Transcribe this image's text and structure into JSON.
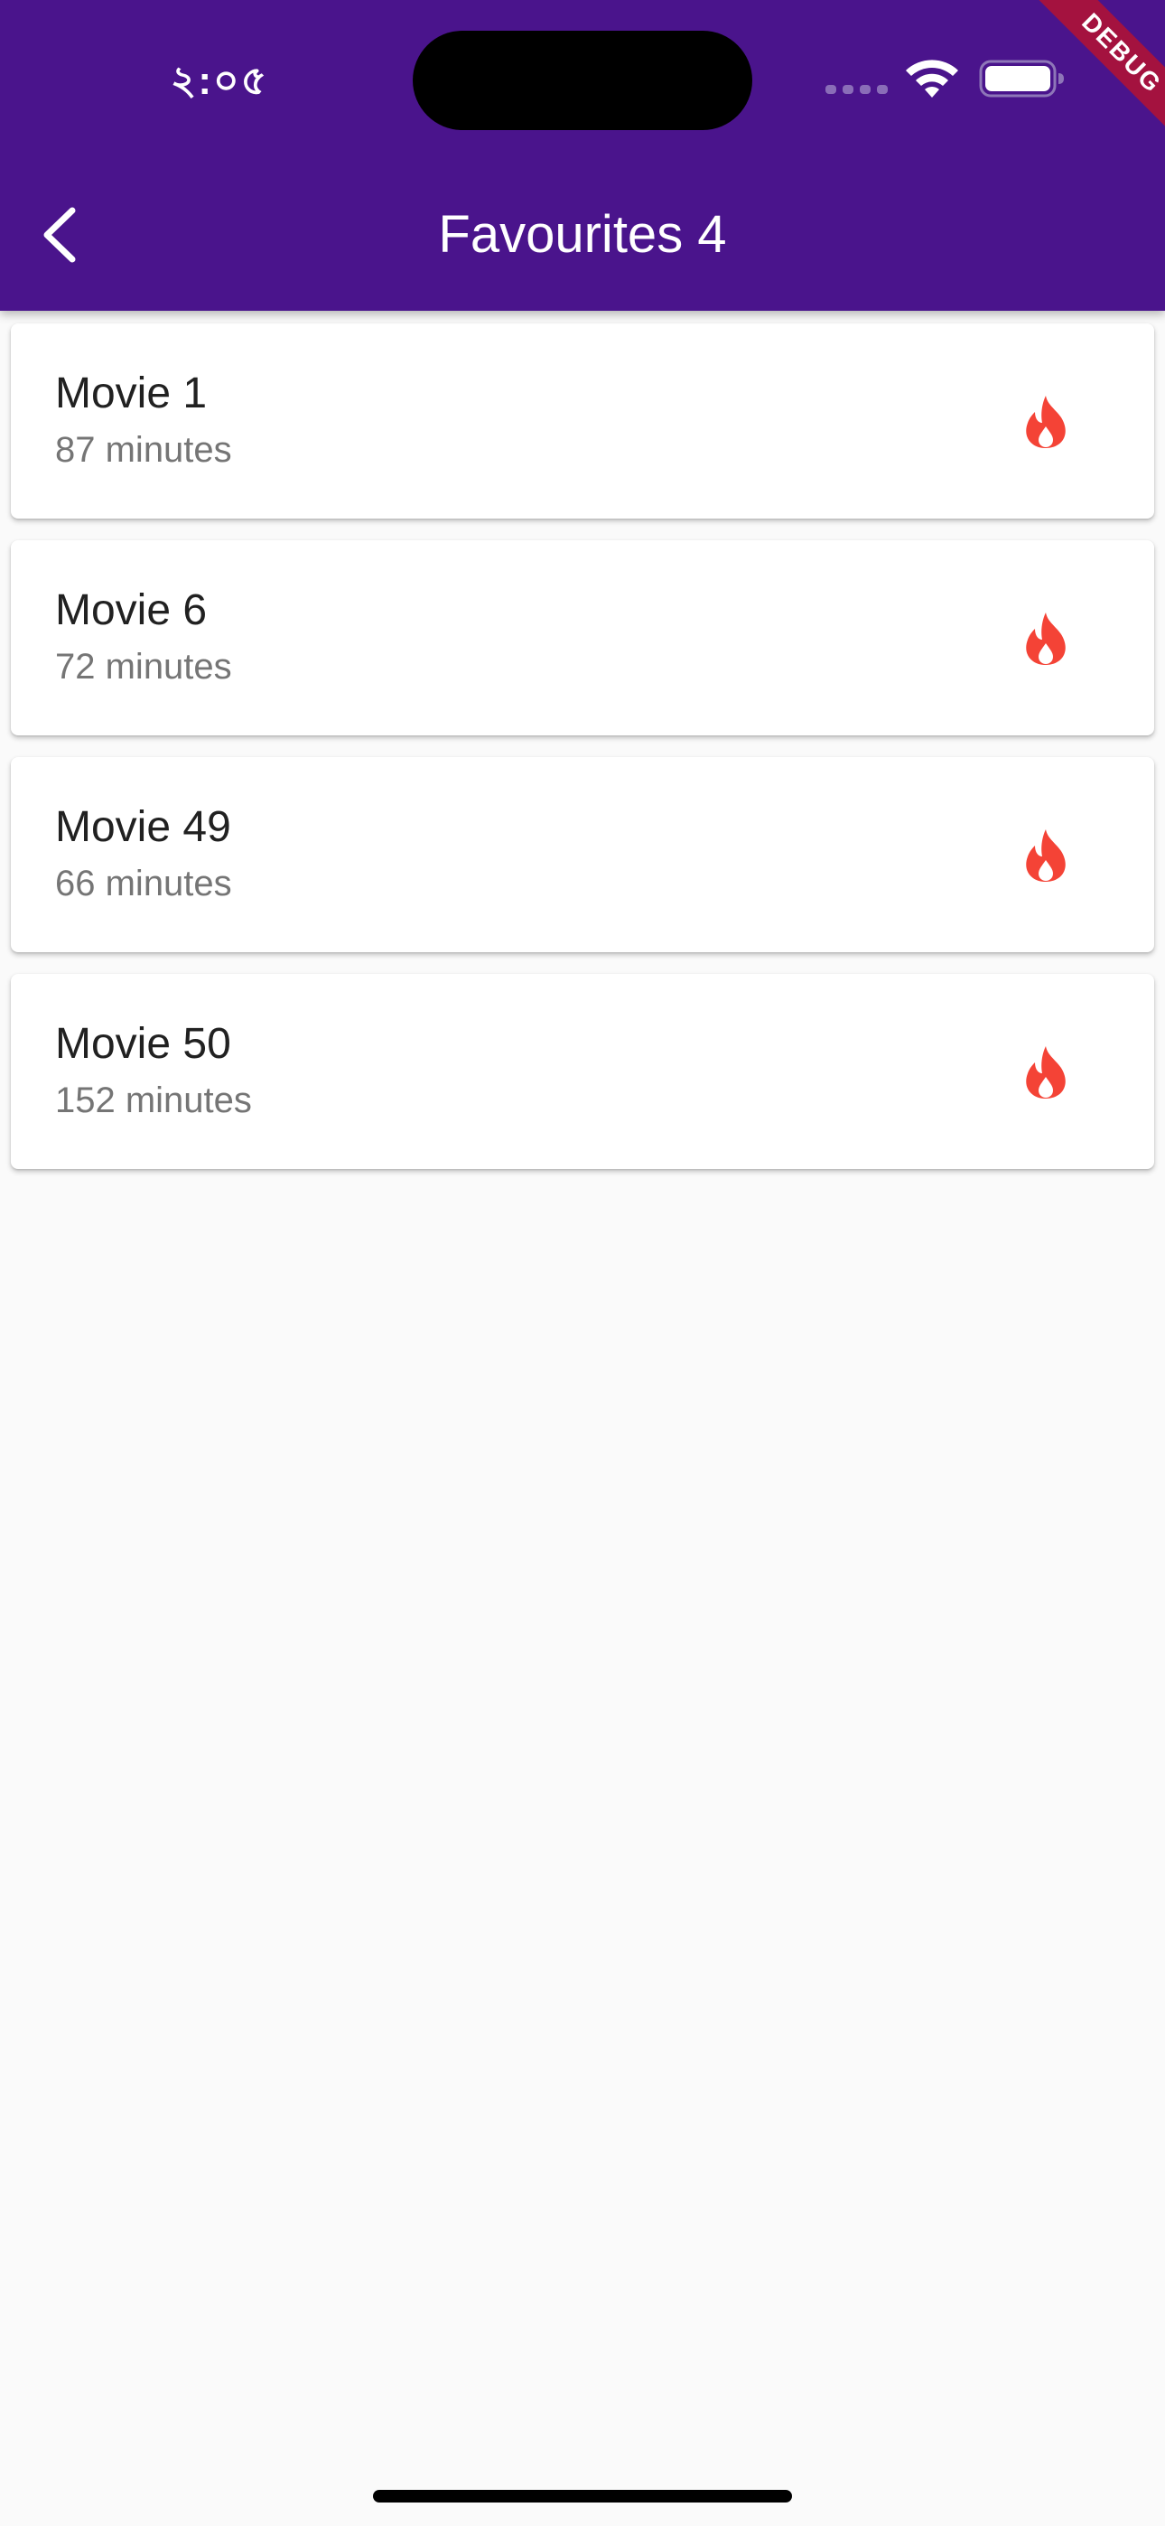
{
  "status_bar": {
    "time": "২:০৫",
    "wifi_icon": "wifi-icon",
    "battery_icon": "battery-icon",
    "signal_icon": "signal-dots-icon"
  },
  "debug_banner": {
    "label": "DEBUG"
  },
  "app_bar": {
    "title": "Favourites 4",
    "back_icon": "chevron-left-icon"
  },
  "movies": [
    {
      "title": "Movie 1",
      "duration": "87 minutes",
      "icon": "fire-icon"
    },
    {
      "title": "Movie 6",
      "duration": "72 minutes",
      "icon": "fire-icon"
    },
    {
      "title": "Movie 49",
      "duration": "66 minutes",
      "icon": "fire-icon"
    },
    {
      "title": "Movie 50",
      "duration": "152 minutes",
      "icon": "fire-icon"
    }
  ],
  "colors": {
    "app_bar": "#4a148c",
    "background": "#fafafa",
    "card": "#ffffff",
    "fire": "#f44336",
    "debug_ribbon": "#a4123f"
  }
}
